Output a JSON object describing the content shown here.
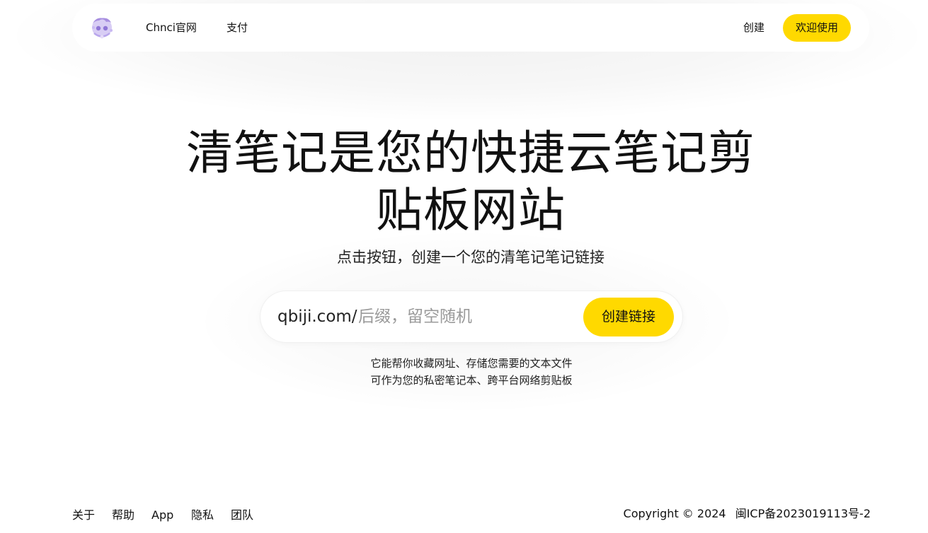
{
  "header": {
    "logo_alt": "logo",
    "nav": [
      {
        "label": "Chnci官网"
      },
      {
        "label": "支付"
      }
    ],
    "create_label": "创建",
    "welcome_label": "欢迎使用"
  },
  "hero": {
    "title": "清笔记是您的快捷云笔记剪贴板网站",
    "subtitle": "点击按钮，创建一个您的清笔记笔记链接"
  },
  "link_form": {
    "prefix": "qbiji.com/",
    "input_value": "",
    "placeholder": "后缀，留空随机",
    "button_label": "创建链接"
  },
  "description": {
    "line1": "它能帮你收藏网址、存储您需要的文本文件",
    "line2": "可作为您的私密笔记本、跨平台网络剪贴板"
  },
  "footer": {
    "links": [
      {
        "label": "关于"
      },
      {
        "label": "帮助"
      },
      {
        "label": "App"
      },
      {
        "label": "隐私"
      },
      {
        "label": "团队"
      }
    ],
    "copyright": "Copyright © 2024",
    "icp": "闽ICP备2023019113号-2"
  },
  "colors": {
    "accent": "#ffd900",
    "text": "#111111",
    "placeholder": "#9a9a9a",
    "logo": "#b7a2e8"
  }
}
